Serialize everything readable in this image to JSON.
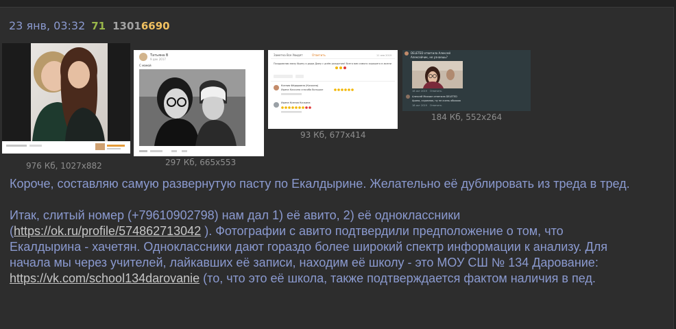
{
  "post": {
    "date": "23 янв, 03:32",
    "counter": "71",
    "number_prefix": "1301",
    "number_suffix": "6690"
  },
  "files": [
    {
      "info": "976 Кб, 1027x882",
      "thumb_label": "Фото: две девушки"
    },
    {
      "info": "297 Кб, 665x553",
      "thumb_label": "Скриншот: чёрно-белое фото"
    },
    {
      "info": "93 Кб, 677x414",
      "thumb_label": "Скриншот: комментарии"
    },
    {
      "info": "184 Кб, 552x264",
      "thumb_label": "Скриншот: сообщения"
    }
  ],
  "thumb_text": {
    "t2_name": "Татьяна В",
    "t2_date": "9 дек 2017",
    "t2_caption": "С мамой",
    "t3_tab1": "Заметка Все Увидят",
    "t3_tab2": "Ответить",
    "t3_date": "11 янв 2019",
    "t3_post": "Поздравляю маму Ирину и дядю Диму с днём рождения! Всего вам самого хорошего в жизни",
    "t3_c1_name": "Ксения Фёдоровна (Кочкина)",
    "t3_c1_text": "Ирина Кочкина спасибо большое",
    "t3_c2_name": "Ирина Ксения Кочкина",
    "t4_header": "DELETED ответила Алексей",
    "t4_msg1": "Алексейчик, не узнаешь?",
    "t4_time1": "18 окт 2019",
    "t4_reply1": "Ответить",
    "t4_msg2": "Алексей Михаил ответила DELETED",
    "t4_msg3": "Арина, скромная, ну не очень обожаю",
    "t4_time2": "18 окт 2019",
    "t4_reply2": "Ответить"
  },
  "message": {
    "p1": "Короче, составляю самую развернутую пасту по Екалдырине. Желательно её дублировать из треда в тред.",
    "p2_l1": "Итак, слитый номер (+79610902798) нам дал 1) её авито, 2) её одноклассники",
    "p2_l2_pre": "(",
    "link1": "https://ok.ru/profile/574862713042",
    "p2_l2_post": " ). Фотографии с авито подтвердили предположение о том, что",
    "p2_l3": "Екалдырина - хачетян. Одноклассники дают гораздо более широкий спектр информации к анализу. Для",
    "p2_l4": "начала мы через учителей, лайкавших её записи, находим её школу - это МОУ СШ № 134 Дарование:",
    "link2": "https://vk.com/school134darovanie",
    "p2_l5_post": " (то, что это её школа, также подтверждается фактом наличия в пед."
  }
}
